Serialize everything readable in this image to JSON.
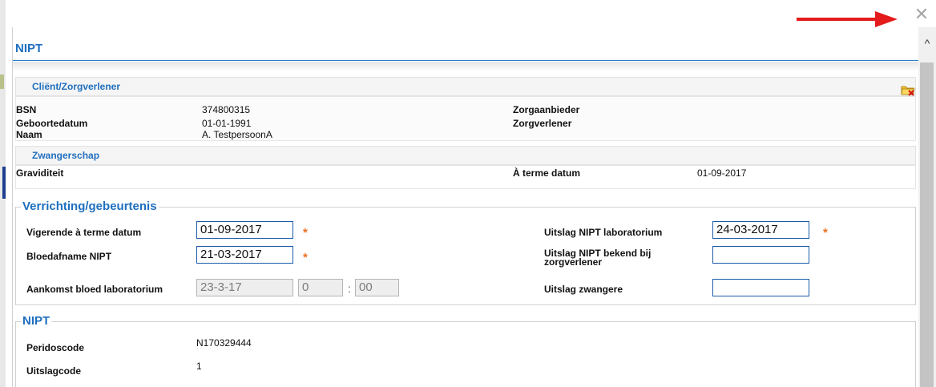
{
  "window": {
    "close_symbol": "✕",
    "scroll_up_symbol": "^"
  },
  "dialog": {
    "title": "NIPT"
  },
  "client": {
    "heading": "Cliënt/Zorgverlener",
    "bsn_label": "BSN",
    "bsn_value": "374800315",
    "birth_label": "Geboortedatum",
    "birth_value": "01-01-1991",
    "name_label": "Naam",
    "name_value": "A. TestpersoonA",
    "provider_label": "Zorgaanbieder",
    "caregiver_label": "Zorgverlener"
  },
  "pregnancy": {
    "heading": "Zwangerschap",
    "gravidity_label": "Graviditeit",
    "due_label": "À terme datum",
    "due_value": "01-09-2017"
  },
  "procedure": {
    "legend": "Verrichting/gebeurtenis",
    "due_date_label": "Vigerende à terme datum",
    "due_date_value": "01-09-2017",
    "blood_draw_label": "Bloedafname NIPT",
    "blood_draw_value": "21-03-2017",
    "arrival_label": "Aankomst bloed laboratorium",
    "arrival_date": "23-3-17",
    "arrival_hour": "0",
    "arrival_sep": ":",
    "arrival_min": "00",
    "lab_result_label": "Uitslag NIPT laboratorium",
    "lab_result_value": "24-03-2017",
    "known_label": "Uitslag NIPT bekend bij zorgverlener",
    "known_value": "",
    "pregnant_result_label": "Uitslag zwangere",
    "pregnant_result_value": "",
    "required_mark": "*"
  },
  "nipt": {
    "legend": "NIPT",
    "perido_label": "Peridoscode",
    "perido_value": "N170329444",
    "result_code_label": "Uitslagcode",
    "result_code_value": "1"
  },
  "colors": {
    "accent": "#1f6fbf",
    "required": "#f07020",
    "annotation_arrow": "#e41b1b"
  },
  "icons": {
    "close": "close-icon",
    "folder": "folder-delete-icon",
    "arrow": "red-arrow-annotation",
    "scroll": "chevron-up-icon"
  }
}
